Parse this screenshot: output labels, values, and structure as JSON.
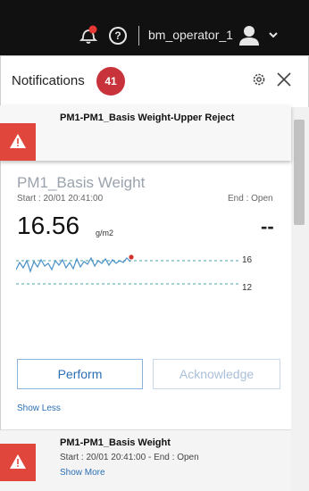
{
  "topbar": {
    "username": "bm_operator_1",
    "help_glyph": "?",
    "icons": [
      "bell-icon",
      "help-icon",
      "user-icon",
      "chevron-down-icon"
    ],
    "notification_dot_color": "#e53935"
  },
  "header": {
    "title": "Notifications",
    "count": "41",
    "count_color": "#c8323a",
    "icons": [
      "gear-icon",
      "close-icon"
    ]
  },
  "alerts": [
    {
      "title": "PM1-PM1_Basis Weight-Upper Reject",
      "icon": "warning-icon",
      "color": "#e0463c"
    },
    {
      "title": "PM1-PM1_Basis Weight",
      "subtitle": "Start : 20/01 20:41:00  -  End : Open",
      "more": "Show More",
      "icon": "warning-icon",
      "color": "#e0463c"
    }
  ],
  "detail": {
    "title": "PM1_Basis Weight",
    "start": "Start : 20/01 20:41:00",
    "end": "End : Open",
    "value": "16.56",
    "unit": "g/m2",
    "secondary_value": "--",
    "limit_high": "16",
    "limit_low": "12",
    "perform_label": "Perform",
    "acknowledge_label": "Acknowledge",
    "show_less": "Show Less"
  }
}
